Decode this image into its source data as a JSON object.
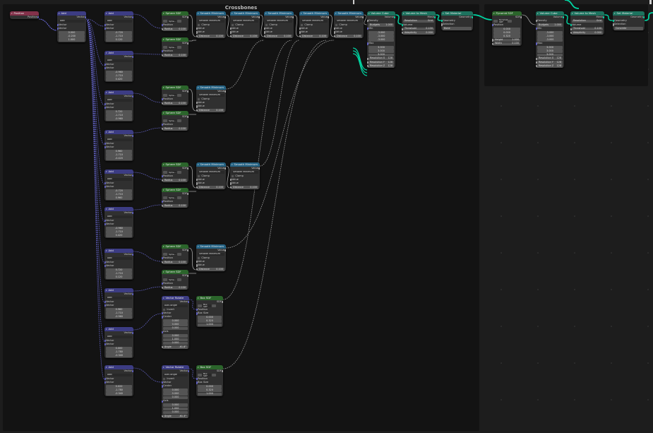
{
  "frames": {
    "left": "Crossbones"
  },
  "labels": {
    "position": "Position",
    "add": "Add",
    "vector": "Vector",
    "geometry": "Geometry",
    "value": "Value",
    "volume": "Volume",
    "mesh": "Mesh",
    "sdf": "SDF",
    "smooth_min": "Smooth Minimum",
    "clamp": "Clamp",
    "distance": "Distance",
    "radius": "Radius",
    "density": "Density",
    "min": "Min",
    "max": "Max",
    "resolution": "Resolution",
    "threshold": "Threshold",
    "adaptivity": "Adaptivity",
    "selection": "Selection",
    "material": "Material",
    "height": "Height",
    "width": "Width",
    "center": "Center",
    "invert": "Invert",
    "axis": "Axis",
    "angle": "Angle",
    "type": "Type",
    "box_size": "Box Size",
    "budgets": "Budgets",
    "res_x": "Resolution X",
    "res_y": "Resolution Y",
    "res_z": "Resolution Z"
  },
  "nodes": {
    "position_title": "Position",
    "add_title": "Add",
    "sphere_title": "Sphere SDF",
    "smooth_title": "Smooth Minimum",
    "volcube_title": "Volume Cube",
    "vol2mesh_title": "Volume to Mesh",
    "setmat_title": "Set Material",
    "pyramid_title": "Pyramid SDF",
    "vecrot_title": "Vector Rotate",
    "box_title": "Box SDF",
    "sphere_short": "Sphe...",
    "smooth_mode": "Smooth Minimum",
    "grid": "Grid",
    "bone_mat": "Bone",
    "concrete_mat": "Concrete",
    "axis_angle": "Axis Angle",
    "pyramid_sdf": "Pyramid SDF",
    "box_sdf": "Box SDF"
  },
  "values": {
    "first_add": [
      "0.000",
      "-0.200",
      "1.000"
    ],
    "adds": [
      [
        "-0.720",
        "-1.710",
        "0.120"
      ],
      [
        "-0.960",
        "-1.710",
        "0.420"
      ],
      [
        "0.720",
        "-1.710",
        "-0.960"
      ],
      [
        "0.960",
        "-1.710",
        "-0.420"
      ],
      [
        "-0.720",
        "-1.710",
        "0.960"
      ],
      [
        "-0.960",
        "-1.710",
        "0.420"
      ],
      [
        "0.720",
        "-1.710",
        "0.120"
      ],
      [
        "0.960",
        "-1.710",
        "-0.960"
      ],
      [
        "0.000",
        "-1.780",
        "-0.340"
      ],
      [
        "0.020",
        "-1.780",
        "-0.340"
      ]
    ],
    "radius": "0.100",
    "radius2": "0.320",
    "distance": "0.100",
    "budgets": "1.000",
    "min": [
      "-3.000",
      "-3.000",
      "-3.000"
    ],
    "max": [
      "3.000",
      "3.000",
      "3.000"
    ],
    "res": "128",
    "threshold": "0.100",
    "adaptivity": "0.000",
    "pyr_pos": [
      "0.000",
      "0.000",
      "0.320"
    ],
    "pyr_height": "1.000",
    "pyr_width": "0.100",
    "rot_center": [
      "0.000",
      "0.000",
      "0.000"
    ],
    "rot_axis": [
      "0.000",
      "1.000",
      "0.000"
    ],
    "rot_angle": "-61.8°",
    "rot_angle2": "-61.3°",
    "box_size": [
      "0.000",
      "0.320",
      "1.000"
    ]
  },
  "colors": {
    "geometry_wire": "#00d6a3",
    "vector_wire": "#6363c7",
    "float_wire": "#a1a1a1"
  }
}
